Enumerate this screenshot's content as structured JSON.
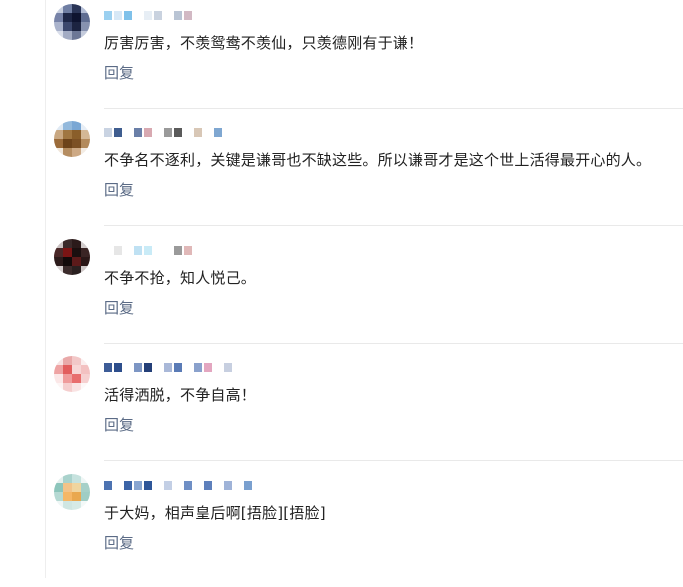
{
  "comments": [
    {
      "text": "厉害厉害，不羡鸳鸯不羡仙，只羡德刚有于谦！",
      "reply_label": "回复",
      "avatar_colors": [
        "#c7cfe0",
        "#6f7ea3",
        "#2a3557",
        "#b4bed6",
        "#7783a8",
        "#1e2747",
        "#0e1430",
        "#5f6d92",
        "#aab3cc",
        "#3c486d",
        "#1c2441",
        "#8792b0",
        "#d9deea",
        "#a3acc4",
        "#6c7796",
        "#c4cbdc"
      ],
      "name_colors": [
        "#9bd0f0",
        "#d7e8f6",
        "#7fc1ea",
        "#ffffff",
        "#e7eef5",
        "#c9d2df",
        "#ffffff",
        "#b9c4d4",
        "#d2b9c4",
        "#ffffff"
      ]
    },
    {
      "text": "不争名不逐利，关键是谦哥也不缺这些。所以谦哥才是这个世上活得最开心的人。",
      "reply_label": "回复",
      "avatar_colors": [
        "#dfe9f3",
        "#93b9dc",
        "#7aa7d4",
        "#e7eef6",
        "#c9a882",
        "#a07641",
        "#8a5e2a",
        "#d4b896",
        "#9b6b3a",
        "#6d431a",
        "#7c5024",
        "#b38a5c",
        "#f0e6da",
        "#b58d61",
        "#cda985",
        "#f3ece4"
      ],
      "name_colors": [
        "#c9d3e2",
        "#3f5d8f",
        "#ffffff",
        "#6a7fa8",
        "#d8a9b1",
        "#ffffff",
        "#9a9a9a",
        "#5a5a5a",
        "#ffffff",
        "#d8c7b6",
        "#ffffff",
        "#7fa7d1"
      ]
    },
    {
      "text": "不争不抢，知人悦己。",
      "reply_label": "回复",
      "avatar_colors": [
        "#c9c1c1",
        "#3a2a2a",
        "#2b1a1a",
        "#d2cccc",
        "#4a2828",
        "#7a1414",
        "#1b0f0f",
        "#3a2424",
        "#2c1b1b",
        "#120a0a",
        "#5c1a1a",
        "#2a1717",
        "#d8d2d2",
        "#3c2c2c",
        "#2a2020",
        "#cfc8c8"
      ],
      "name_colors": [
        "#ffffff",
        "#e6e6e6",
        "#ffffff",
        "#bfe1f3",
        "#c9ebf7",
        "#ffffff",
        "#ffffff",
        "#9a9a9a",
        "#e0b8b8",
        "#ffffff"
      ]
    },
    {
      "text": "活得洒脱，不争自高！",
      "reply_label": "回复",
      "avatar_colors": [
        "#f7e4e4",
        "#e9a9a9",
        "#f2c8c8",
        "#fbeeee",
        "#eea3a3",
        "#e25d5d",
        "#f7d6d6",
        "#f3c1c1",
        "#fbe7e7",
        "#ef9b9b",
        "#e86d6d",
        "#f6d0d0",
        "#fdf5f5",
        "#f5cece",
        "#f9e3e3",
        "#fdf8f8"
      ],
      "name_colors": [
        "#3d5c97",
        "#2d4e8c",
        "#ffffff",
        "#7d96c4",
        "#243f78",
        "#ffffff",
        "#a9b8d8",
        "#5a7bb6",
        "#ffffff",
        "#8aa1cc",
        "#e3a6c0",
        "#ffffff",
        "#c7cfe0"
      ]
    },
    {
      "text": "于大妈，相声皇后啊[捂脸][捂脸]",
      "reply_label": "回复",
      "avatar_colors": [
        "#e4f0ee",
        "#a9d2cc",
        "#c6e2de",
        "#eef6f5",
        "#8cc5bb",
        "#f2c389",
        "#f0d59f",
        "#a6d0c8",
        "#b5d9d3",
        "#f5b766",
        "#e9a84f",
        "#9fcdc4",
        "#eef6f5",
        "#cfe6e2",
        "#d6eae6",
        "#f4f9f8"
      ],
      "name_colors": [
        "#4d73b1",
        "#ffffff",
        "#3c64a7",
        "#88a5d1",
        "#2e5699",
        "#ffffff",
        "#c3cfe5",
        "#ffffff",
        "#6f8fc5",
        "#ffffff",
        "#5e80bc",
        "#ffffff",
        "#9fb3d8",
        "#ffffff",
        "#7aa0cf"
      ]
    }
  ]
}
